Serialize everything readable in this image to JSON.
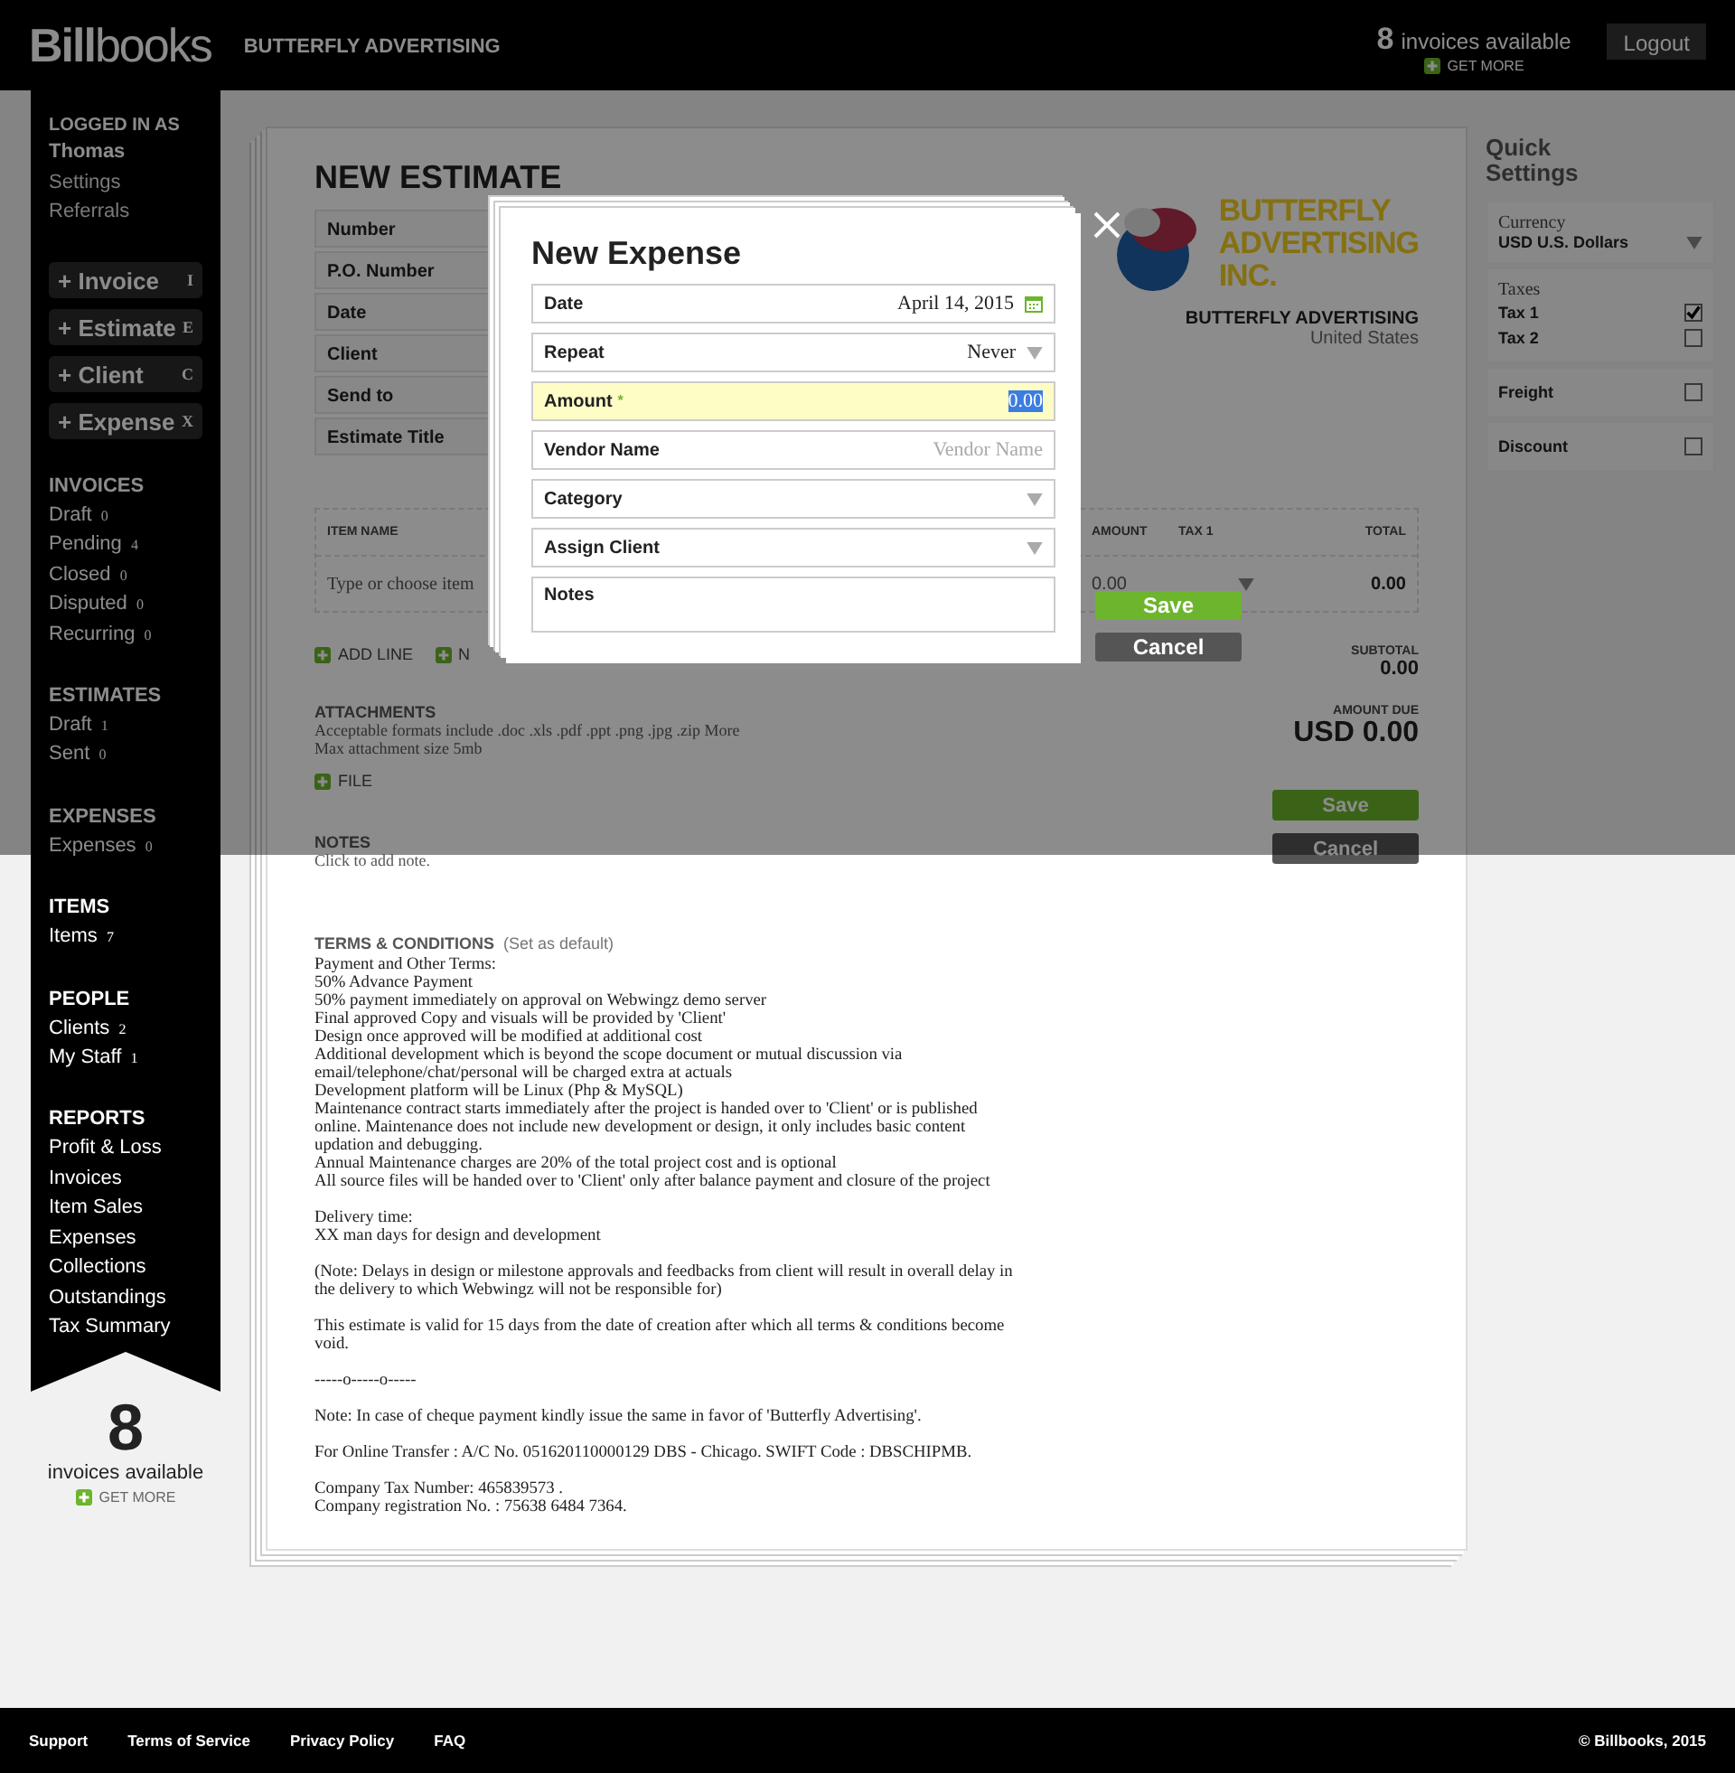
{
  "header": {
    "logo_bold": "Bill",
    "logo_light": "books",
    "company": "BUTTERFLY ADVERTISING",
    "invoices_count": "8",
    "invoices_label": "invoices available",
    "get_more": "GET MORE",
    "logout": "Logout"
  },
  "sidebar": {
    "logged_in_label": "LOGGED IN AS",
    "user": "Thomas",
    "links": [
      "Settings",
      "Referrals"
    ],
    "quick_buttons": [
      {
        "label": "+ Invoice",
        "shortcut": "I"
      },
      {
        "label": "+ Estimate",
        "shortcut": "E"
      },
      {
        "label": "+ Client",
        "shortcut": "C"
      },
      {
        "label": "+ Expense",
        "shortcut": "X"
      }
    ],
    "sections": [
      {
        "title": "INVOICES",
        "items": [
          {
            "label": "Draft",
            "count": "0"
          },
          {
            "label": "Pending",
            "count": "4"
          },
          {
            "label": "Closed",
            "count": "0"
          },
          {
            "label": "Disputed",
            "count": "0"
          },
          {
            "label": "Recurring",
            "count": "0"
          }
        ]
      },
      {
        "title": "ESTIMATES",
        "items": [
          {
            "label": "Draft",
            "count": "1"
          },
          {
            "label": "Sent",
            "count": "0"
          }
        ]
      },
      {
        "title": "EXPENSES",
        "items": [
          {
            "label": "Expenses",
            "count": "0"
          }
        ]
      },
      {
        "title": "ITEMS",
        "items": [
          {
            "label": "Items",
            "count": "7"
          }
        ]
      },
      {
        "title": "PEOPLE",
        "items": [
          {
            "label": "Clients",
            "count": "2"
          },
          {
            "label": "My Staff",
            "count": "1"
          }
        ]
      },
      {
        "title": "REPORTS",
        "items": [
          {
            "label": "Profit & Loss"
          },
          {
            "label": "Invoices"
          },
          {
            "label": "Item Sales"
          },
          {
            "label": "Expenses"
          },
          {
            "label": "Collections"
          },
          {
            "label": "Outstandings"
          },
          {
            "label": "Tax Summary"
          }
        ]
      }
    ],
    "bottom": {
      "count": "8",
      "label": "invoices available",
      "get_more": "GET MORE"
    }
  },
  "estimate": {
    "title": "NEW ESTIMATE",
    "fields": [
      "Number",
      "P.O. Number",
      "Date",
      "Client",
      "Send to",
      "Estimate Title"
    ],
    "company_logo": [
      "BUTTERFLY",
      "ADVERTISING",
      "INC."
    ],
    "company_name": "BUTTERFLY ADVERTISING",
    "company_country": "United States",
    "items_table": {
      "columns": [
        "ITEM NAME",
        "AMOUNT",
        "TAX 1",
        "TOTAL"
      ],
      "item_placeholder": "Type or choose item",
      "amount": "0.00",
      "total": "0.00"
    },
    "add_buttons": [
      "ADD LINE",
      "N"
    ],
    "attachments": {
      "title": "ATTACHMENTS",
      "formats": "Acceptable formats include .doc .xls .pdf .ppt .png .jpg .zip",
      "more_link": "More",
      "max_size": "Max attachment size 5mb",
      "file_button": "FILE"
    },
    "subtotal_label": "SUBTOTAL",
    "subtotal": "0.00",
    "amount_due_label": "AMOUNT DUE",
    "amount_due": "USD 0.00",
    "buttons": [
      {
        "label": "Save",
        "kind": "primary"
      },
      {
        "label": "Cancel",
        "kind": "secondary"
      }
    ],
    "notes": {
      "title": "NOTES",
      "placeholder": "Click to add note."
    },
    "terms": {
      "title": "TERMS & CONDITIONS",
      "set_default": "(Set as default)",
      "paragraphs": [
        [
          "Payment and Other Terms:",
          "50% Advance Payment",
          "50% payment immediately on approval on Webwingz demo server",
          "Final approved Copy and visuals will be provided by 'Client'",
          "Design once approved will be modified at additional cost",
          "Additional development which is beyond the scope document or mutual discussion via",
          "email/telephone/chat/personal will be charged extra at actuals",
          "Development platform will be Linux (Php & MySQL)",
          "Maintenance contract starts immediately after the project is handed over to 'Client' or is published",
          "online. Maintenance does not include new development or design, it only includes basic content",
          "updation and debugging.",
          "Annual Maintenance charges are 20% of the total project cost and is optional",
          "All source files will be handed over to 'Client' only after balance payment and closure of the project"
        ],
        [
          "Delivery time:",
          "XX man days for design and development"
        ],
        [
          "(Note: Delays in design or milestone approvals and feedbacks from client will result in overall delay in",
          "the delivery to which Webwingz will not be responsible for)"
        ],
        [
          "This estimate is valid for 15 days from the date of creation after which all terms & conditions become",
          "void."
        ],
        [
          "-----o-----o-----"
        ],
        [
          "Note: In case of cheque payment kindly issue the same in favor of 'Butterfly Advertising'."
        ],
        [
          "For Online Transfer : A/C No. 051620110000129 DBS - Chicago. SWIFT Code : DBSCHIPMB."
        ],
        [
          "Company Tax Number: 465839573 .",
          "Company registration No. : 75638 6484 7364."
        ]
      ]
    }
  },
  "quick_settings": {
    "title": "Quick Settings",
    "currency_label": "Currency",
    "currency": "USD U.S. Dollars",
    "taxes_label": "Taxes",
    "taxes": [
      {
        "label": "Tax 1",
        "checked": true
      },
      {
        "label": "Tax 2",
        "checked": false
      }
    ],
    "options": [
      {
        "label": "Freight",
        "checked": false
      },
      {
        "label": "Discount",
        "checked": false
      }
    ]
  },
  "modal": {
    "title": "New Expense",
    "fields": [
      {
        "label": "Date",
        "kind": "date",
        "value": "April 14, 2015",
        "focused": false
      },
      {
        "label": "Repeat",
        "kind": "select",
        "value": "Never",
        "focused": false
      },
      {
        "label": "Amount",
        "kind": "input",
        "required_mark": "*",
        "value": "0.00",
        "focused": true
      },
      {
        "label": "Vendor Name",
        "kind": "input",
        "placeholder": "Vendor Name",
        "focused": false
      },
      {
        "label": "Category",
        "kind": "select",
        "focused": false
      },
      {
        "label": "Assign Client",
        "kind": "select",
        "focused": false
      },
      {
        "label": "Notes",
        "kind": "textarea",
        "focused": false
      }
    ],
    "buttons": [
      {
        "label": "Save",
        "kind": "primary"
      },
      {
        "label": "Cancel",
        "kind": "secondary"
      }
    ]
  },
  "footer": {
    "links": [
      "Support",
      "Terms of Service",
      "Privacy Policy",
      "FAQ"
    ],
    "copyright": "© Billbooks, 2015"
  }
}
